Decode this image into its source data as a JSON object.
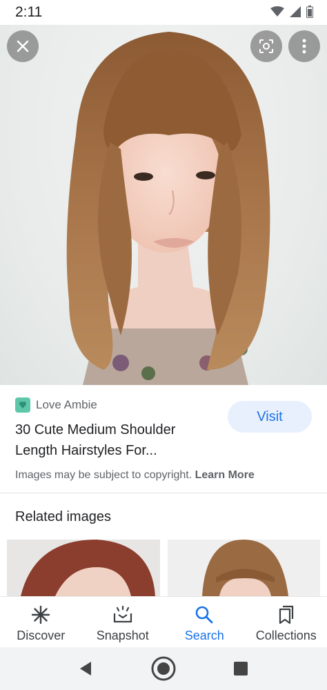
{
  "status": {
    "time": "2:11"
  },
  "source": {
    "name": "Love Ambie"
  },
  "result": {
    "title_line1": "30 Cute Medium Shoulder",
    "title_line2": "Length Hairstyles For..."
  },
  "visit_label": "Visit",
  "copyright": {
    "text": "Images may be subject to copyright.",
    "link": "Learn More"
  },
  "related": {
    "title": "Related images"
  },
  "nav": [
    {
      "label": "Discover",
      "icon": "asterisk-icon"
    },
    {
      "label": "Snapshot",
      "icon": "snapshot-icon"
    },
    {
      "label": "Search",
      "icon": "search-icon"
    },
    {
      "label": "Collections",
      "icon": "collections-icon"
    }
  ],
  "colors": {
    "accent": "#1a73e8",
    "visit_bg": "#e8f0fe"
  }
}
